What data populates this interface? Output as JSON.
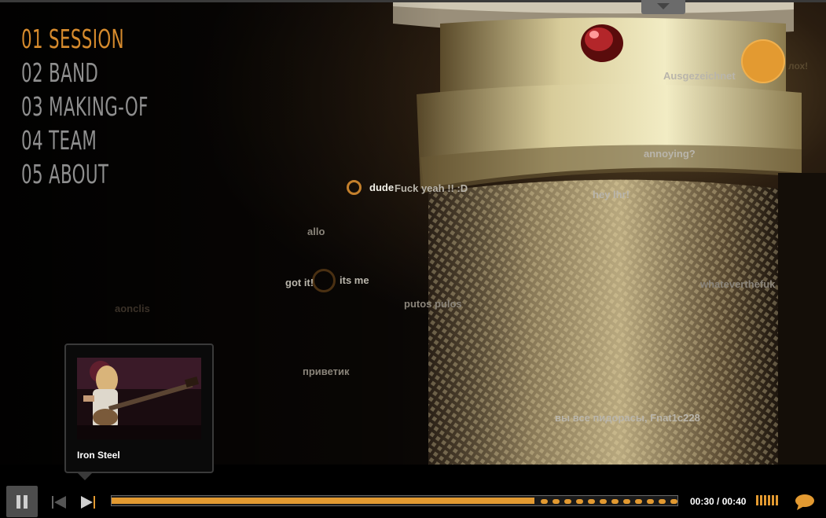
{
  "nav": {
    "items": [
      {
        "label": "01 SESSION",
        "active": true
      },
      {
        "label": "02 BAND",
        "active": false
      },
      {
        "label": "03 MAKING-OF",
        "active": false
      },
      {
        "label": "04 TEAM",
        "active": false
      },
      {
        "label": "05 ABOUT",
        "active": false
      }
    ]
  },
  "comments": [
    "Ausgezeichnet",
    "лох!",
    "annoying?",
    "dude",
    "Fuck yeah !! :D",
    "hey lhr!",
    "allo",
    "got it!",
    "its me",
    "whateverthefuk",
    "putos pulos",
    "приветик",
    "вы все пидорасы, Fnat1c228",
    "aonclis"
  ],
  "thumbnail": {
    "title": "Iron Steel"
  },
  "player": {
    "current_time": "00:30",
    "separator": " / ",
    "total_time": "00:40",
    "progress": 0.75,
    "state": "playing",
    "volume_bars": 6
  },
  "colors": {
    "accent": "#e39a31",
    "menu_active": "#d58a2d",
    "menu_inactive": "#8f8f8f",
    "bar_bg": "#000000"
  },
  "icons": {
    "pause": "pause-icon",
    "prev": "skip-back-icon",
    "next": "skip-forward-icon",
    "volume": "volume-icon",
    "comment": "speech-bubble-icon"
  }
}
